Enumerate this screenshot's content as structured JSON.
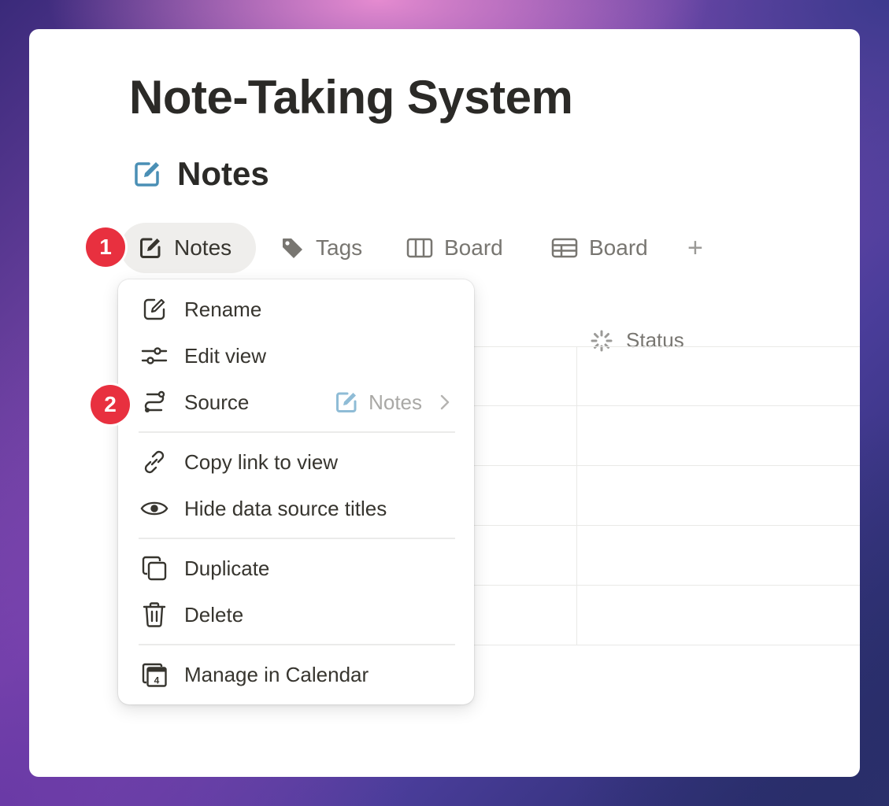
{
  "page": {
    "title": "Note-Taking System"
  },
  "database": {
    "name": "Notes",
    "icon": "edit-square-icon",
    "icon_color": "#4a8fb5"
  },
  "tabs": [
    {
      "label": "Notes",
      "icon": "edit-square-icon",
      "active": true
    },
    {
      "label": "Tags",
      "icon": "tag-icon"
    },
    {
      "label": "Board",
      "icon": "board-columns-icon"
    },
    {
      "label": "Board",
      "icon": "table-grid-icon"
    },
    {
      "label": "+",
      "icon": "plus-icon"
    }
  ],
  "badges": {
    "step1": "1",
    "step2": "2",
    "color": "#e8303f"
  },
  "table": {
    "status_header": "Status",
    "status_icon": "status-spinner-icon"
  },
  "menu": {
    "items": [
      {
        "label": "Rename",
        "icon": "rename-icon"
      },
      {
        "label": "Edit view",
        "icon": "sliders-icon"
      },
      {
        "label": "Source",
        "icon": "source-icon",
        "value": "Notes"
      },
      {
        "label": "Copy link to view",
        "icon": "link-icon"
      },
      {
        "label": "Hide data source titles",
        "icon": "eye-icon"
      },
      {
        "label": "Duplicate",
        "icon": "duplicate-icon"
      },
      {
        "label": "Delete",
        "icon": "trash-icon"
      },
      {
        "label": "Manage in Calendar",
        "icon": "calendar-icon",
        "calendar_day": "4"
      }
    ]
  }
}
